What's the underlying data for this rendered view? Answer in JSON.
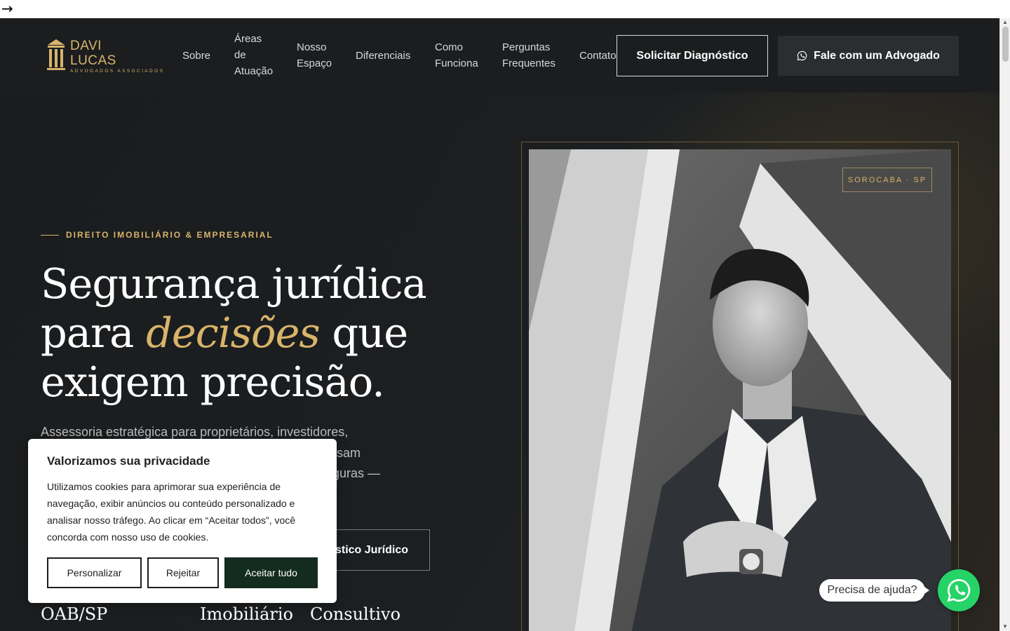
{
  "header": {
    "logo": {
      "name_line1": "DAVI",
      "name_line2": "LUCAS",
      "tagline": "ADVOGADOS ASSOCIADOS"
    },
    "nav": [
      {
        "label_lines": [
          "Sobre"
        ]
      },
      {
        "label_lines": [
          "Áreas",
          "de",
          "Atuação"
        ]
      },
      {
        "label_lines": [
          "Nosso",
          "Espaço"
        ]
      },
      {
        "label_lines": [
          "Diferenciais"
        ]
      },
      {
        "label_lines": [
          "Como",
          "Funciona"
        ]
      },
      {
        "label_lines": [
          "Perguntas",
          "Frequentes"
        ]
      },
      {
        "label_lines": [
          "Contato"
        ]
      }
    ],
    "cta_outline": "Solicitar Diagnóstico",
    "cta_whatsapp": "Fale com um Advogado"
  },
  "hero": {
    "eyebrow": "DIREITO IMOBILIÁRIO & EMPRESARIAL",
    "headline": {
      "line1": "Segurança jurídica",
      "line2_before": "para ",
      "line2_accent": "decisões",
      "line2_after": " que",
      "line3": "exigem precisão."
    },
    "lede_lines": [
      "Assessoria estratégica para proprietários, investidores,",
      "sam",
      "eguras —"
    ],
    "secondary_button": "stico Jurídico",
    "stats": [
      "OAB/SP",
      "Imobiliário",
      "Consultivo"
    ],
    "location_badge": "SOROCABA · SP"
  },
  "cookie": {
    "title": "Valorizamos sua privacidade",
    "body": "Utilizamos cookies para aprimorar sua experiência de navegação, exibir anúncios ou conteúdo personalizado e analisar nosso tráfego. Ao clicar em “Aceitar todos”, você concorda com nosso uso de cookies.",
    "btn_customize": "Personalizar",
    "btn_reject": "Rejeitar",
    "btn_accept": "Aceitar tudo"
  },
  "chat": {
    "bubble": "Precisa de ajuda?"
  },
  "browser": {
    "top_arrow": "→"
  },
  "colors": {
    "gold": "#d8b46a",
    "dark": "#1b1d1f",
    "accept": "#142b1f",
    "whatsapp": "#25d366"
  },
  "icons": [
    "whatsapp-icon",
    "column-logo-icon",
    "arrow-right-icon"
  ]
}
